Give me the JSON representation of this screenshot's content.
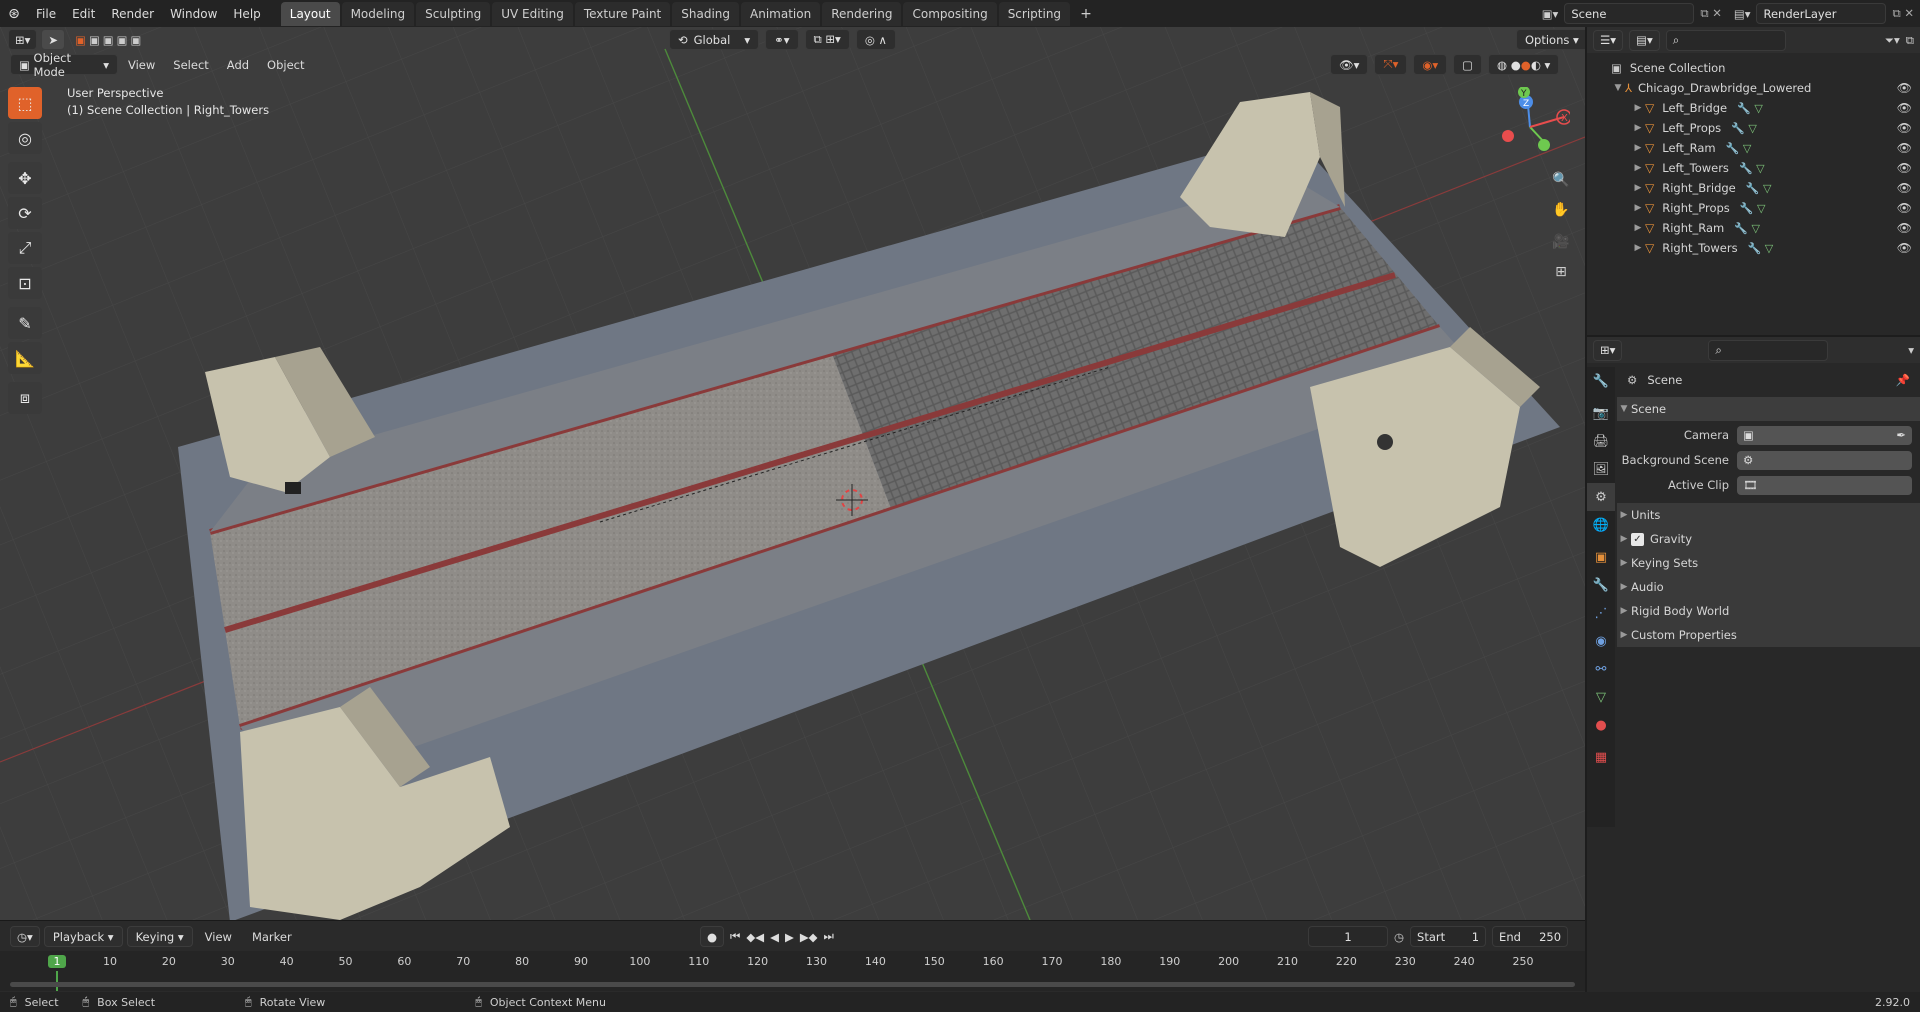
{
  "topbar": {
    "menus": [
      "File",
      "Edit",
      "Render",
      "Window",
      "Help"
    ],
    "workspaces": [
      "Layout",
      "Modeling",
      "Sculpting",
      "UV Editing",
      "Texture Paint",
      "Shading",
      "Animation",
      "Rendering",
      "Compositing",
      "Scripting"
    ],
    "active_workspace": "Layout",
    "add_tab": "+",
    "scene_field": "Scene",
    "renderlayer_field": "RenderLayer"
  },
  "viewport_header": {
    "mode": "Object Mode",
    "menus": [
      "View",
      "Select",
      "Add",
      "Object"
    ],
    "orientation": "Global",
    "options": "Options"
  },
  "viewport": {
    "perspective_label": "User Perspective",
    "context_label": "(1) Scene Collection | Right_Towers",
    "gizmo_axes": [
      "X",
      "Y",
      "Z"
    ]
  },
  "tools": [
    "select-box",
    "cursor",
    "move",
    "rotate",
    "scale",
    "transform",
    "annotate",
    "measure",
    "add-cube"
  ],
  "timeline": {
    "menus": [
      "Playback",
      "Keying",
      "View",
      "Marker"
    ],
    "current_frame": "1",
    "start_label": "Start",
    "start": "1",
    "end_label": "End",
    "end": "250",
    "ruler": [
      "1",
      "10",
      "20",
      "30",
      "40",
      "50",
      "60",
      "70",
      "80",
      "90",
      "100",
      "110",
      "120",
      "130",
      "140",
      "150",
      "160",
      "170",
      "180",
      "190",
      "200",
      "210",
      "220",
      "230",
      "240",
      "250"
    ]
  },
  "statusbar": {
    "items": [
      "Select",
      "Box Select",
      "Rotate View",
      "Object Context Menu"
    ],
    "version": "2.92.0"
  },
  "outliner": {
    "root": "Scene Collection",
    "collection": "Chicago_Drawbridge_Lowered",
    "objects": [
      "Left_Bridge",
      "Left_Props",
      "Left_Ram",
      "Left_Towers",
      "Right_Bridge",
      "Right_Props",
      "Right_Ram",
      "Right_Towers"
    ]
  },
  "properties": {
    "context_title": "Scene",
    "panel_title": "Scene",
    "fields": [
      {
        "label": "Camera",
        "value": ""
      },
      {
        "label": "Background Scene",
        "value": ""
      },
      {
        "label": "Active Clip",
        "value": ""
      }
    ],
    "collapsed_panels": [
      "Units",
      "Gravity",
      "Keying Sets",
      "Audio",
      "Rigid Body World",
      "Custom Properties"
    ],
    "gravity_checked": true
  },
  "colors": {
    "accent": "#e0622a",
    "x_axis": "#e84d4d",
    "y_axis": "#6ec94f",
    "z_axis": "#4d8ee8",
    "object_icon": "#e5903a"
  }
}
